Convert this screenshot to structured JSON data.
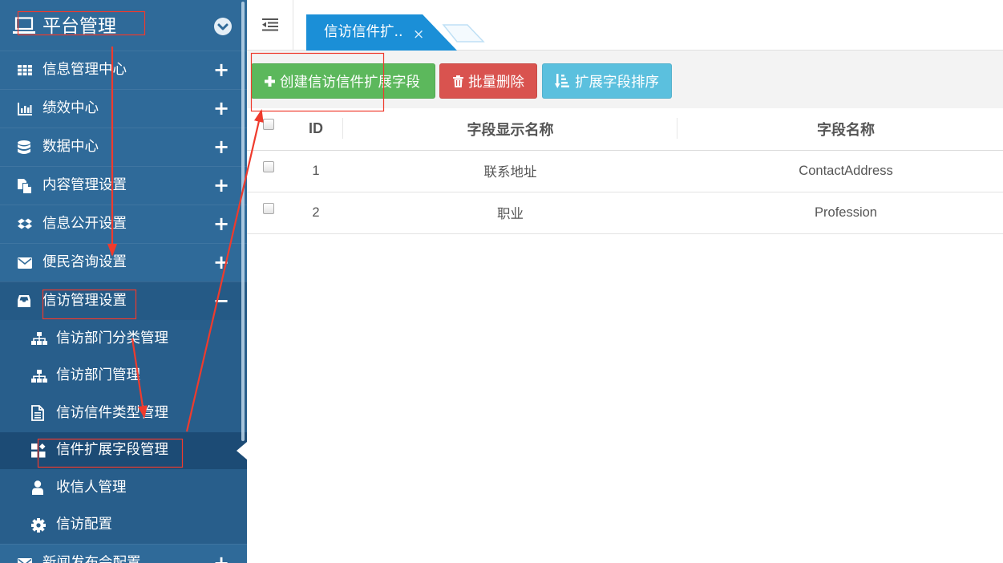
{
  "colors": {
    "sidebar_bg": "#2f6a99",
    "sidebar_open_bg": "#255a86",
    "sidebar_sub_bg": "#285e8b",
    "sidebar_active_bg": "#1c4b75",
    "tab_bg": "#1b8fd7",
    "btn_create": "#5cb85c",
    "btn_delete": "#d9534f",
    "btn_sort": "#5bc0de",
    "annotation": "#ef3b2d"
  },
  "sidebar": {
    "title": "平台管理",
    "title_icon": "laptop-icon",
    "collapse_icon": "chevron-circle-down-icon",
    "items": [
      {
        "label": "信息管理中心",
        "icon": "th-icon",
        "toggle": "+"
      },
      {
        "label": "绩效中心",
        "icon": "bar-chart-icon",
        "toggle": "+"
      },
      {
        "label": "数据中心",
        "icon": "database-icon",
        "toggle": "+"
      },
      {
        "label": "内容管理设置",
        "icon": "files-icon",
        "toggle": "+"
      },
      {
        "label": "信息公开设置",
        "icon": "dropbox-icon",
        "toggle": "+"
      },
      {
        "label": "便民咨询设置",
        "icon": "envelope-icon",
        "toggle": "+"
      },
      {
        "label": "信访管理设置",
        "icon": "inbox-icon",
        "toggle": "−",
        "expanded": true,
        "children": [
          {
            "label": "信访部门分类管理",
            "icon": "sitemap-icon"
          },
          {
            "label": "信访部门管理",
            "icon": "sitemap-icon"
          },
          {
            "label": "信访信件类型管理",
            "icon": "file-text-icon"
          },
          {
            "label": "信件扩展字段管理",
            "icon": "th-large-icon",
            "active": true
          },
          {
            "label": "收信人管理",
            "icon": "user-icon"
          },
          {
            "label": "信访配置",
            "icon": "gear-icon"
          }
        ]
      },
      {
        "label": "新闻发布会配置",
        "icon": "envelope-icon",
        "toggle": "+"
      }
    ]
  },
  "topbar": {
    "toggle_icon": "outdent-icon",
    "tabs": [
      {
        "label": "信访信件扩..",
        "close": "×",
        "active": true
      }
    ]
  },
  "toolbar": {
    "create_label": "创建信访信件扩展字段",
    "create_icon": "plus-icon",
    "delete_label": "批量删除",
    "delete_icon": "trash-icon",
    "sort_label": "扩展字段排序",
    "sort_icon": "sort-amount-icon"
  },
  "table": {
    "columns": [
      "ID",
      "字段显示名称",
      "字段名称"
    ],
    "rows": [
      {
        "id": "1",
        "display_name": "联系地址",
        "field_name": "ContactAddress"
      },
      {
        "id": "2",
        "display_name": "职业",
        "field_name": "Profession"
      }
    ]
  }
}
